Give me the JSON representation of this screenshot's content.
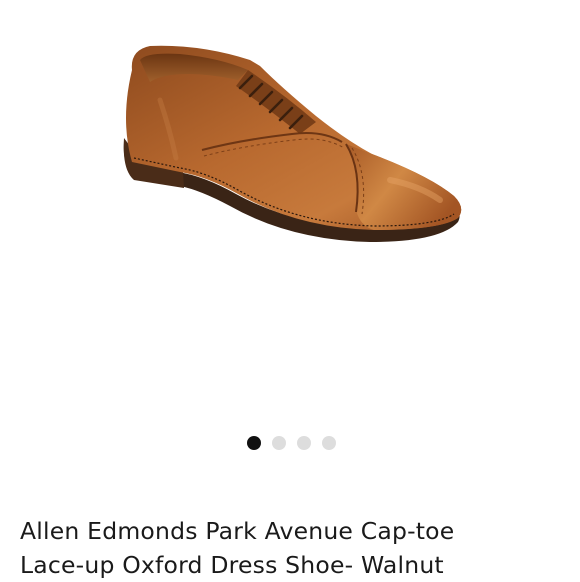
{
  "product": {
    "title_line1": "Allen Edmonds Park Avenue Cap-toe",
    "title_line2": "Lace-up Oxford Dress Shoe- Walnut",
    "image_icon": "shoe-photo"
  },
  "carousel": {
    "total": 4,
    "active_index": 0
  },
  "colors": {
    "active_dot": "#111111",
    "inactive_dot": "#dddddd",
    "leather": "#a55a2a"
  }
}
